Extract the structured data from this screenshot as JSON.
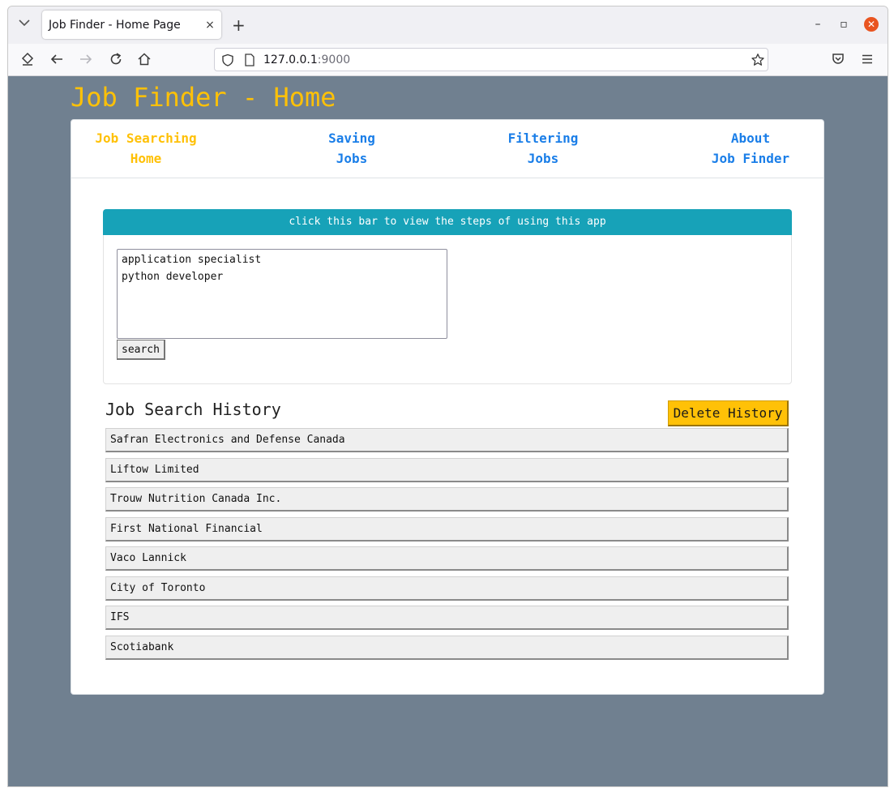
{
  "browser": {
    "tab_title": "Job Finder - Home Page",
    "tab_close": "×",
    "new_tab": "+",
    "url_host": "127.0.0.1",
    "url_port": ":9000",
    "window_minimize": "–",
    "window_maximize": "▫",
    "window_close": "✕"
  },
  "site": {
    "title": "Job Finder - Home"
  },
  "nav": {
    "items": [
      {
        "line1": "Job Searching",
        "line2": "Home",
        "active": true
      },
      {
        "line1": "Saving",
        "line2": "Jobs",
        "active": false
      },
      {
        "line1": "Filtering",
        "line2": "Jobs",
        "active": false
      },
      {
        "line1": "About",
        "line2": "Job Finder",
        "active": false
      }
    ]
  },
  "steps_bar": {
    "label": "click this bar to view the steps of using this app"
  },
  "search": {
    "query": "application specialist\npython developer",
    "button_label": "search"
  },
  "history": {
    "title": "Job Search History",
    "delete_label": "Delete History",
    "items": [
      "Safran Electronics and Defense Canada",
      "Liftow Limited",
      "Trouw Nutrition Canada Inc.",
      "First National Financial",
      "Vaco Lannick",
      "City of Toronto",
      "IFS",
      "Scotiabank"
    ]
  },
  "colors": {
    "page_background": "#708090",
    "accent_yellow": "#ffc107",
    "link_blue": "#1a7ee8",
    "steps_bar_teal": "#17a2b8"
  }
}
